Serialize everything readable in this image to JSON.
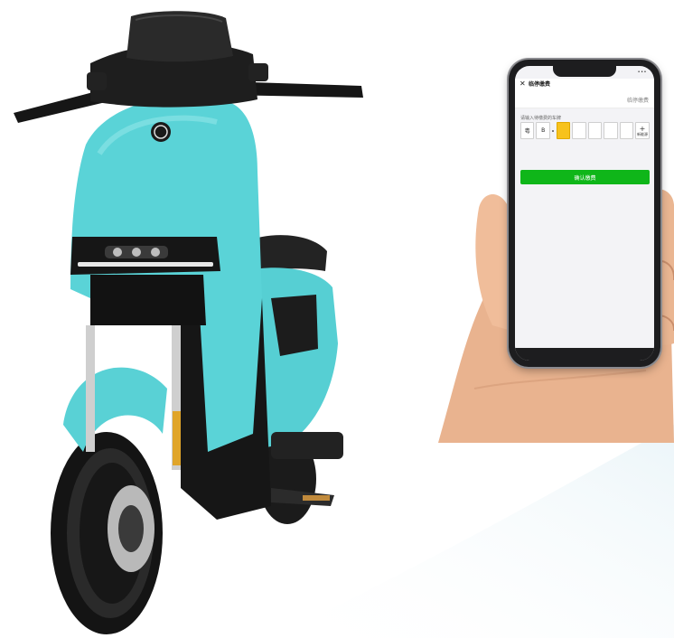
{
  "app": {
    "title": "临停缴费",
    "subheader_link": "临停缴费",
    "status_indicator": "•••"
  },
  "plate_entry": {
    "prompt": "请输入待缴费的车牌",
    "province": "粤",
    "letter": "B",
    "boxes": [
      "",
      "",
      "",
      "",
      "",
      ""
    ],
    "active_index": 0,
    "add_label_top": "+",
    "add_label_bottom": "新能源"
  },
  "confirm": {
    "label": "确认缴费"
  },
  "colors": {
    "scooter_body": "#58d3d6",
    "confirm_green": "#0fb619",
    "active_box": "#f7c21c"
  }
}
